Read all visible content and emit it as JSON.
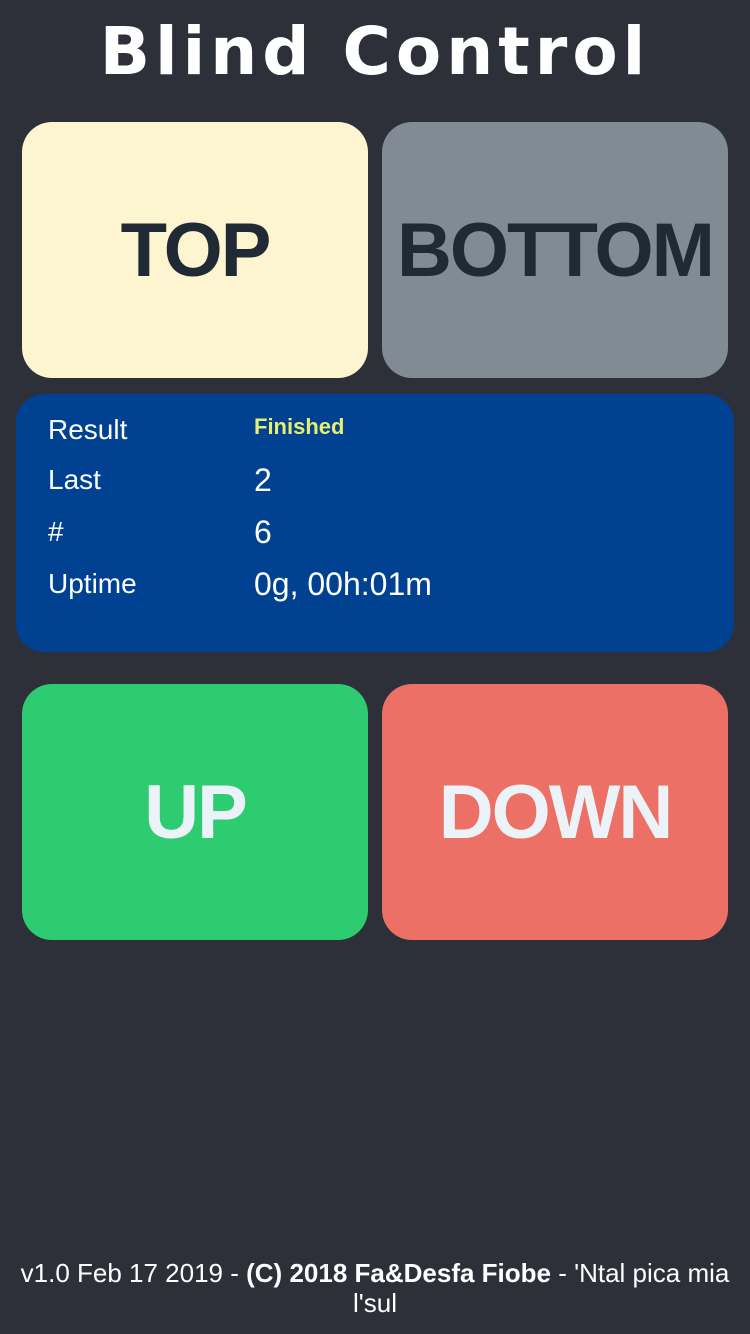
{
  "header": {
    "title": "Blind Control"
  },
  "controls": {
    "top_label": "TOP",
    "bottom_label": "BOTTOM",
    "up_label": "UP",
    "down_label": "DOWN"
  },
  "status": {
    "result_label": "Result",
    "result_value": "Finished",
    "last_label": "Last",
    "last_value": "2",
    "count_label": "#",
    "count_value": "6",
    "uptime_label": "Uptime",
    "uptime_value": "0g, 00h:01m"
  },
  "footer": {
    "version": "v1.0 Feb 17 2019 - ",
    "copyright": "(C) 2018 Fa&Desfa Fiobe",
    "motto": " - 'Ntal pica mia l'sul"
  },
  "colors": {
    "background": "#2d3039",
    "top_button": "#fdf4d0",
    "bottom_button": "#818b94",
    "status_panel": "#004192",
    "result_text": "#e7ef6e",
    "up_button": "#2ecc71",
    "down_button": "#ec7065"
  }
}
